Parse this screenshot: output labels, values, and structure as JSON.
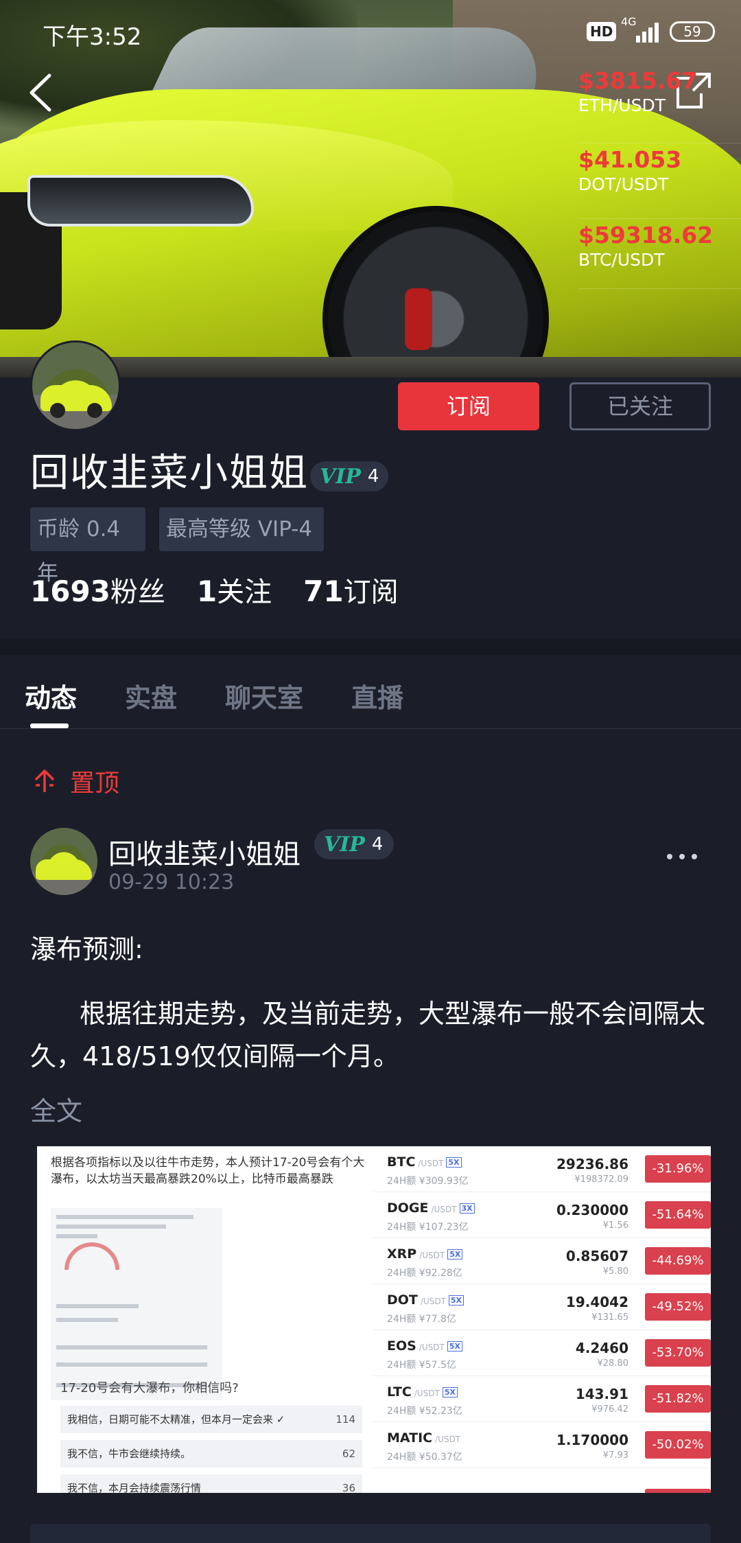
{
  "status_bar": {
    "time": "下午3:52",
    "hd": "HD",
    "network": "4G",
    "battery": "59"
  },
  "tickers": [
    {
      "price": "$3815.67",
      "pair": "ETH/USDT"
    },
    {
      "price": "$41.053",
      "pair": "DOT/USDT"
    },
    {
      "price": "$59318.62",
      "pair": "BTC/USDT"
    }
  ],
  "profile": {
    "name": "回收韭菜小姐姐",
    "vip_mark": "VIP",
    "vip_level": "4",
    "subscribe_label": "订阅",
    "following_label": "已关注",
    "tags": [
      "币龄 0.4年",
      "最高等级 VIP-4"
    ],
    "stats": [
      {
        "value": "1693",
        "label": "粉丝"
      },
      {
        "value": "1",
        "label": "关注"
      },
      {
        "value": "71",
        "label": "订阅"
      }
    ]
  },
  "tabs": [
    "动态",
    "实盘",
    "聊天室",
    "直播"
  ],
  "active_tab": "动态",
  "pinned_label": "置顶",
  "post": {
    "author": "回收韭菜小姐姐",
    "vip_mark": "VIP",
    "vip_level": "4",
    "time": "09-29 10:23",
    "title": "瀑布预测:",
    "body": "根据往期走势，及当前走势，大型瀑布一般不会间隔太久，418/519仅仅间隔一个月。",
    "full_text_label": "全文"
  },
  "image": {
    "left_text": "根据各项指标以及以往牛市走势，本人预计17-20号会有个大瀑布，以太坊当天最高暴跌20%以上，比特币最高暴跌",
    "poll_question": "17-20号会有大瀑布，你相信吗?",
    "poll_options": [
      {
        "text": "我相信，日期可能不太精准，但本月一定会来 ✓",
        "count": "114"
      },
      {
        "text": "我不信，牛市会继续持续。",
        "count": "62"
      },
      {
        "text": "我不信，本月会持续震荡行情",
        "count": "36"
      }
    ],
    "coins": [
      {
        "symbol": "BTC",
        "quote": "/USDT",
        "leverage": "5X",
        "volume": "24H额 ¥309.93亿",
        "price": "29236.86",
        "cny": "¥198372.09",
        "change": "-31.96%"
      },
      {
        "symbol": "DOGE",
        "quote": "/USDT",
        "leverage": "3X",
        "volume": "24H额 ¥107.23亿",
        "price": "0.230000",
        "cny": "¥1.56",
        "change": "-51.64%"
      },
      {
        "symbol": "XRP",
        "quote": "/USDT",
        "leverage": "5X",
        "volume": "24H额 ¥92.28亿",
        "price": "0.85607",
        "cny": "¥5.80",
        "change": "-44.69%"
      },
      {
        "symbol": "DOT",
        "quote": "/USDT",
        "leverage": "5X",
        "volume": "24H额 ¥77.8亿",
        "price": "19.4042",
        "cny": "¥131.65",
        "change": "-49.52%"
      },
      {
        "symbol": "EOS",
        "quote": "/USDT",
        "leverage": "5X",
        "volume": "24H额 ¥57.5亿",
        "price": "4.2460",
        "cny": "¥28.80",
        "change": "-53.70%"
      },
      {
        "symbol": "LTC",
        "quote": "/USDT",
        "leverage": "5X",
        "volume": "24H额 ¥52.23亿",
        "price": "143.91",
        "cny": "¥976.42",
        "change": "-51.82%"
      },
      {
        "symbol": "MATIC",
        "quote": "/USDT",
        "leverage": "",
        "volume": "24H额 ¥50.37亿",
        "price": "1.170000",
        "cny": "¥7.93",
        "change": "-50.02%"
      }
    ]
  },
  "colors": {
    "background": "#1b1e29",
    "accent_red": "#e8353b",
    "vip_green": "#27b898",
    "muted_text": "#6c7383"
  }
}
